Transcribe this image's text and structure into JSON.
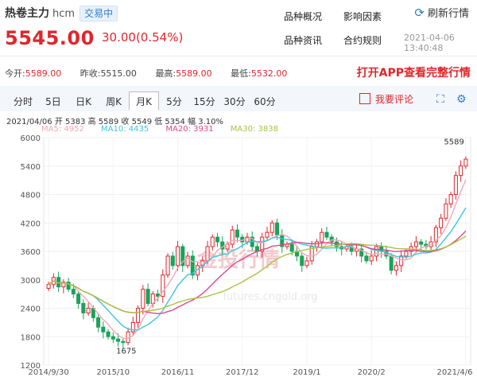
{
  "header": {
    "title": "热卷主力",
    "code": "hcm",
    "tag": "交易中",
    "price": "5545.00",
    "change": "30.00(0.54%)",
    "links": [
      "品种概况",
      "影响因素",
      "品种资讯",
      "合约规则"
    ],
    "refresh": "刷新行情",
    "timestamp": "2021-04-06 13:40:48"
  },
  "stats": {
    "open_label": "今开:",
    "open": "5589.00",
    "prev_label": "昨收:",
    "prev": "5515.00",
    "high_label": "最高:",
    "high": "5589.00",
    "low_label": "最低:",
    "low": "5532.00",
    "promo": "打开APP查看完整行情"
  },
  "tabs": [
    "分时",
    "5日",
    "日K",
    "周K",
    "月K",
    "5分",
    "15分",
    "30分",
    "60分"
  ],
  "active_tab": 4,
  "comment": "我要评论",
  "chart_info": {
    "line": "2021/04/06  开 5383  高 5589  收 5549  低 5354  幅 3.10%",
    "ma5": "MA5: 4952",
    "ma10": "MA10: 4435",
    "ma20": "MA20: 3931",
    "ma30": "MA30: 3838",
    "watermark": "金投行情",
    "watermark_url": "futures.cngold.org"
  },
  "colors": {
    "up": "#e0262c",
    "down": "#1aa35a",
    "ma5": "#f2a7b4",
    "ma10": "#3cc6de",
    "ma20": "#e0468f",
    "ma30": "#a6c43f",
    "accent": "#2f7fd1"
  },
  "chart_data": {
    "type": "candlestick",
    "y_ticks": [
      1200,
      1800,
      2400,
      3000,
      3600,
      4200,
      4800,
      5400,
      6000
    ],
    "ylim": [
      1200,
      6000
    ],
    "x_ticks": [
      "2014/9/30",
      "2015/10",
      "2016/11",
      "2017/12",
      "2019/1",
      "2020/2",
      "2021/4/6"
    ],
    "annotations": [
      {
        "label": "5589",
        "value": 5589
      },
      {
        "label": "1675",
        "value": 1675
      }
    ],
    "closes": [
      2900,
      3050,
      2850,
      2950,
      2800,
      2700,
      2500,
      2300,
      2400,
      2200,
      2000,
      1900,
      1800,
      1750,
      1700,
      1675,
      1900,
      2100,
      2400,
      2800,
      2500,
      2700,
      2650,
      3100,
      3500,
      3300,
      3700,
      3300,
      3500,
      3100,
      3300,
      3400,
      3700,
      3900,
      3800,
      3650,
      3750,
      4050,
      3900,
      3800,
      3900,
      3700,
      3600,
      3900,
      4000,
      4200,
      3950,
      3700,
      3750,
      3600,
      3500,
      3300,
      3400,
      3700,
      3800,
      4000,
      3900,
      3800,
      3700,
      3650,
      3700,
      3600,
      3650,
      3500,
      3400,
      3500,
      3700,
      3600,
      3500,
      3200,
      3300,
      3500,
      3600,
      3700,
      3800,
      3750,
      3700,
      3800,
      4100,
      4300,
      4600,
      4800,
      5200,
      5400,
      5545
    ]
  }
}
